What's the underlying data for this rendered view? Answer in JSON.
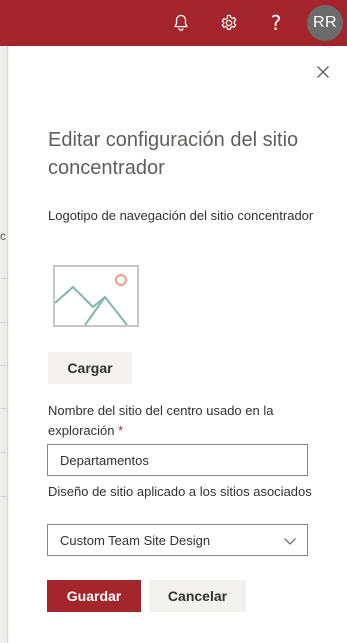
{
  "topbar": {
    "accent": "#a4262c",
    "icons": [
      "bell-icon",
      "gear-icon",
      "help-icon"
    ],
    "help_glyph": "?",
    "avatar_initials": "RR"
  },
  "background": {
    "edge_mark": "c"
  },
  "panel": {
    "title": "Editar configuración del sitio concentrador",
    "logo_label": "Logotipo de navegación del sitio concentrador",
    "upload_label": "Cargar",
    "name_label": "Nombre del sitio del centro usado en la exploración",
    "required_mark": "*",
    "name_value": "Departamentos",
    "design_label": "Diseño de sitio aplicado a los sitios asociados",
    "design_selected": "Custom Team Site Design",
    "save_label": "Guardar",
    "cancel_label": "Cancelar"
  }
}
